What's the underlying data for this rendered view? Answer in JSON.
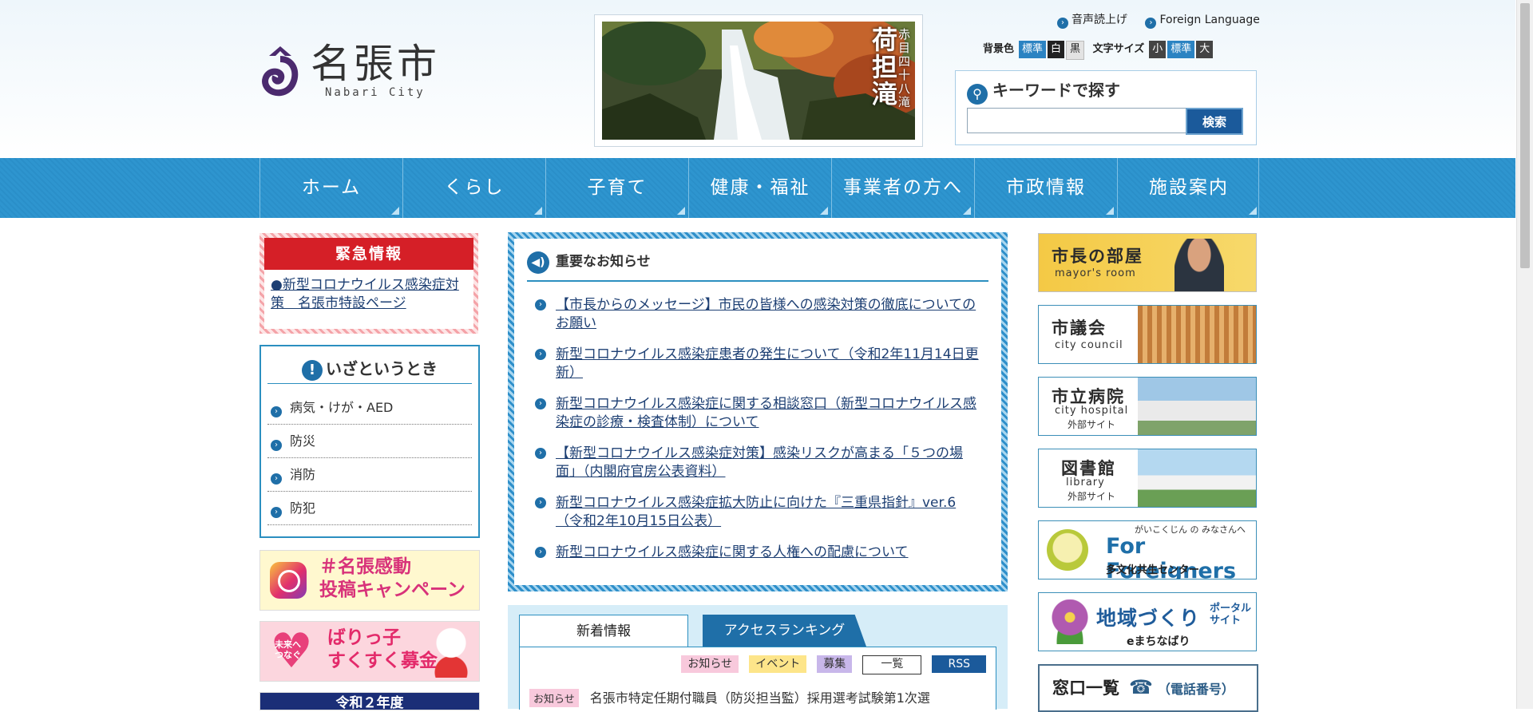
{
  "site": {
    "name": "名張市",
    "name_en": "Nabari City"
  },
  "banner": {
    "title": "荷担滝",
    "subtitle": "赤目四十八滝"
  },
  "util_links": {
    "speech": "音声読上げ",
    "foreign": "Foreign Language"
  },
  "settings": {
    "bg_label": "背景色",
    "bg_standard": "標準",
    "bg_white": "白",
    "bg_black": "黒",
    "font_label": "文字サイズ",
    "font_small": "小",
    "font_standard": "標準",
    "font_large": "大"
  },
  "search": {
    "title": "キーワードで探す",
    "button": "検索",
    "value": ""
  },
  "nav": {
    "items": [
      "ホーム",
      "くらし",
      "子育て",
      "健康・福祉",
      "事業者の方へ",
      "市政情報",
      "施設案内"
    ]
  },
  "emergency": {
    "title": "緊急情報",
    "link": "●新型コロナウイルス感染症対策　名張市特設ページ"
  },
  "izatoki": {
    "title": "いざというとき",
    "items": [
      "病気・けが・AED",
      "防災",
      "消防",
      "防犯"
    ]
  },
  "left_banners": {
    "insta": "＃名張感動\n投稿キャンペーン",
    "heart_text": "未来へ\nつなぐ",
    "bokin": "ばりっ子\nすくすく募金",
    "third": "令和２年度"
  },
  "important": {
    "title": "重要なお知らせ",
    "items": [
      "【市長からのメッセージ】市民の皆様への感染対策の徹底についてのお願い",
      "新型コロナウイルス感染症患者の発生について（令和2年11月14日更新）",
      "新型コロナウイルス感染症に関する相談窓口（新型コロナウイルス感染症の診療・検査体制）について",
      "【新型コロナウイルス感染症対策】感染リスクが高まる「５つの場面」（内閣府官房公表資料）",
      "新型コロナウイルス感染症拡大防止に向けた『三重県指針』ver.6（令和2年10月15日公表）",
      "新型コロナウイルス感染症に関する人権への配慮について"
    ]
  },
  "tabs": {
    "active": "新着情報",
    "inactive": "アクセスランキング",
    "filters": {
      "notice": "お知らせ",
      "event": "イベント",
      "recruit": "募集",
      "list": "一覧",
      "rss": "RSS"
    },
    "latest": {
      "tag": "お知らせ",
      "text": "名張市特定任期付職員（防災担当監）採用選考試験第1次選"
    }
  },
  "right_banners": {
    "mayor": {
      "title": "市長の部屋",
      "sub": "mayor's room"
    },
    "council": {
      "title": "市議会",
      "sub": "city council"
    },
    "hospital": {
      "title": "市立病院",
      "sub": "city hospital",
      "ext": "外部サイト"
    },
    "library": {
      "title": "図書館",
      "sub": "library",
      "ext": "外部サイト"
    },
    "foreigners": {
      "small": "がいこくじん の みなさんへ",
      "title": "For Foreigners",
      "sub": "多文化共生センター（NabiChan)"
    },
    "chiiki": {
      "title": "地域づくり",
      "portal": "ポータル\nサイト",
      "sub": "eまちなばり"
    },
    "madoguchi": {
      "title": "窓口一覧",
      "phone": "（電話番号）"
    }
  },
  "colors": {
    "nav": "#2e95cf",
    "emergency": "#d51f27",
    "link": "#1d3f73",
    "accent": "#1f6fa8"
  }
}
